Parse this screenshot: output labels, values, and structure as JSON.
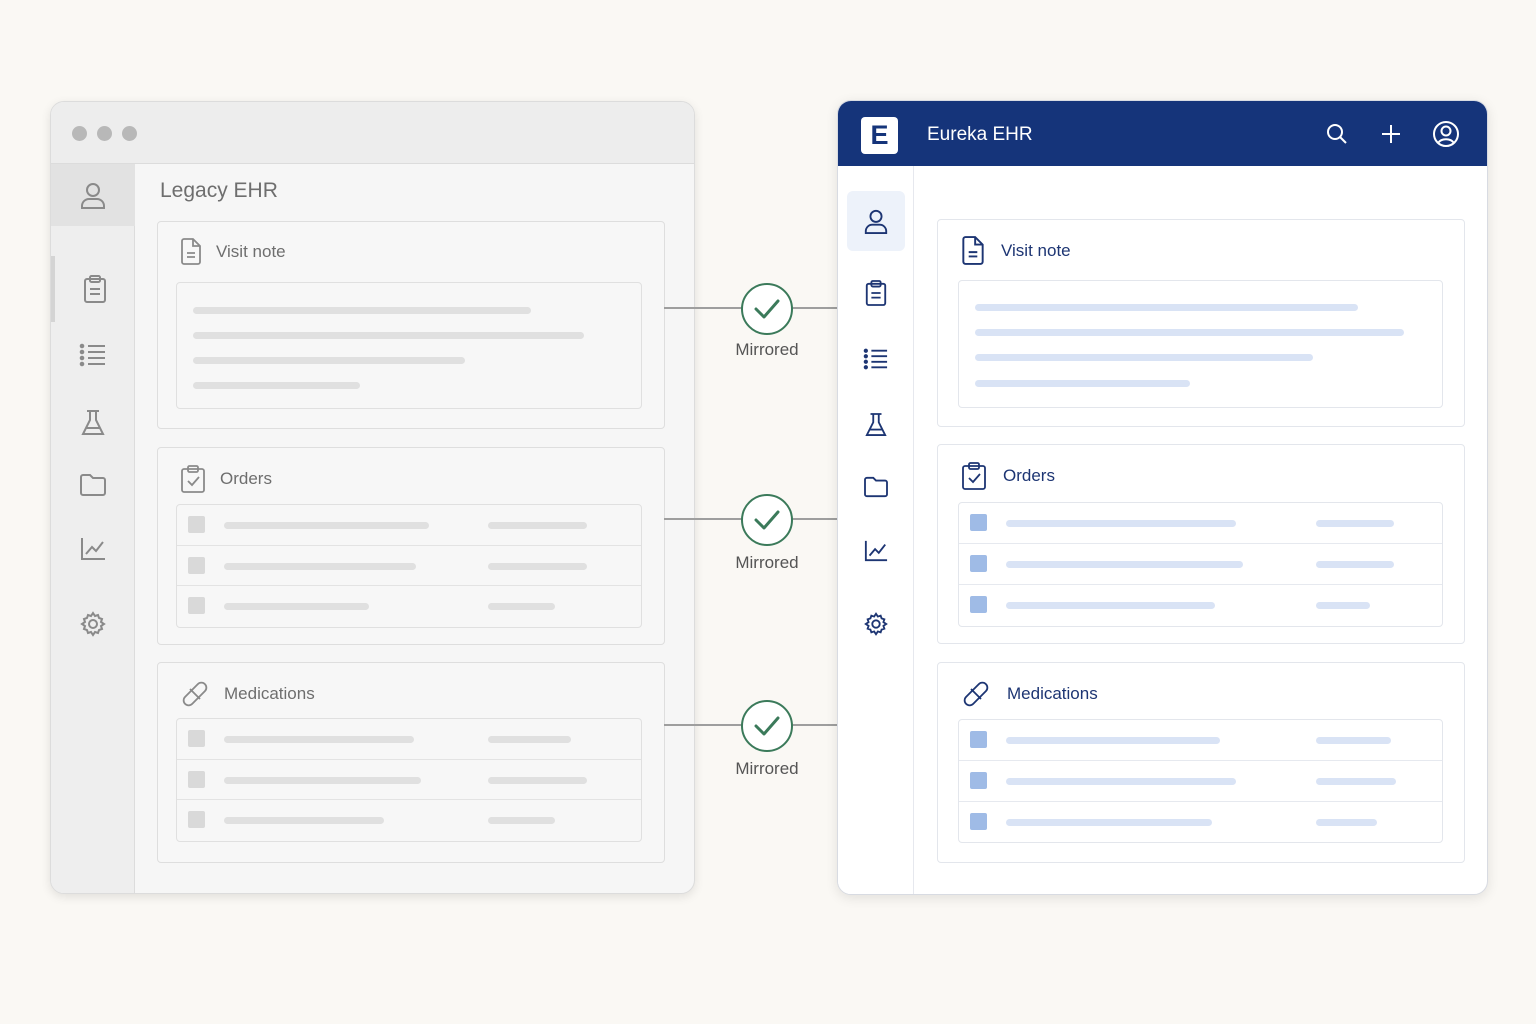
{
  "legacy": {
    "title": "Legacy EHR",
    "sidebar_icons": [
      "user-icon",
      "clipboard-icon",
      "list-icon",
      "flask-icon",
      "folder-icon",
      "chart-icon",
      "gear-icon"
    ],
    "cards": {
      "visit_note": "Visit note",
      "orders": "Orders",
      "medications": "Medications"
    }
  },
  "sync": {
    "labels": [
      "Mirrored",
      "Mirrored",
      "Mirrored"
    ]
  },
  "eureka": {
    "logo_letter": "E",
    "brand": "Eureka EHR",
    "header_icons": [
      "search-icon",
      "plus-icon",
      "account-icon"
    ],
    "sidebar_icons": [
      "user-icon",
      "clipboard-icon",
      "list-icon",
      "flask-icon",
      "folder-icon",
      "chart-icon",
      "gear-icon"
    ],
    "cards": {
      "visit_note": "Visit note",
      "orders": "Orders",
      "medications": "Medications"
    }
  },
  "colors": {
    "eureka_navy": "#15347a",
    "sync_green": "#3b7a5a",
    "legacy_gray": "#8a8a8a"
  }
}
